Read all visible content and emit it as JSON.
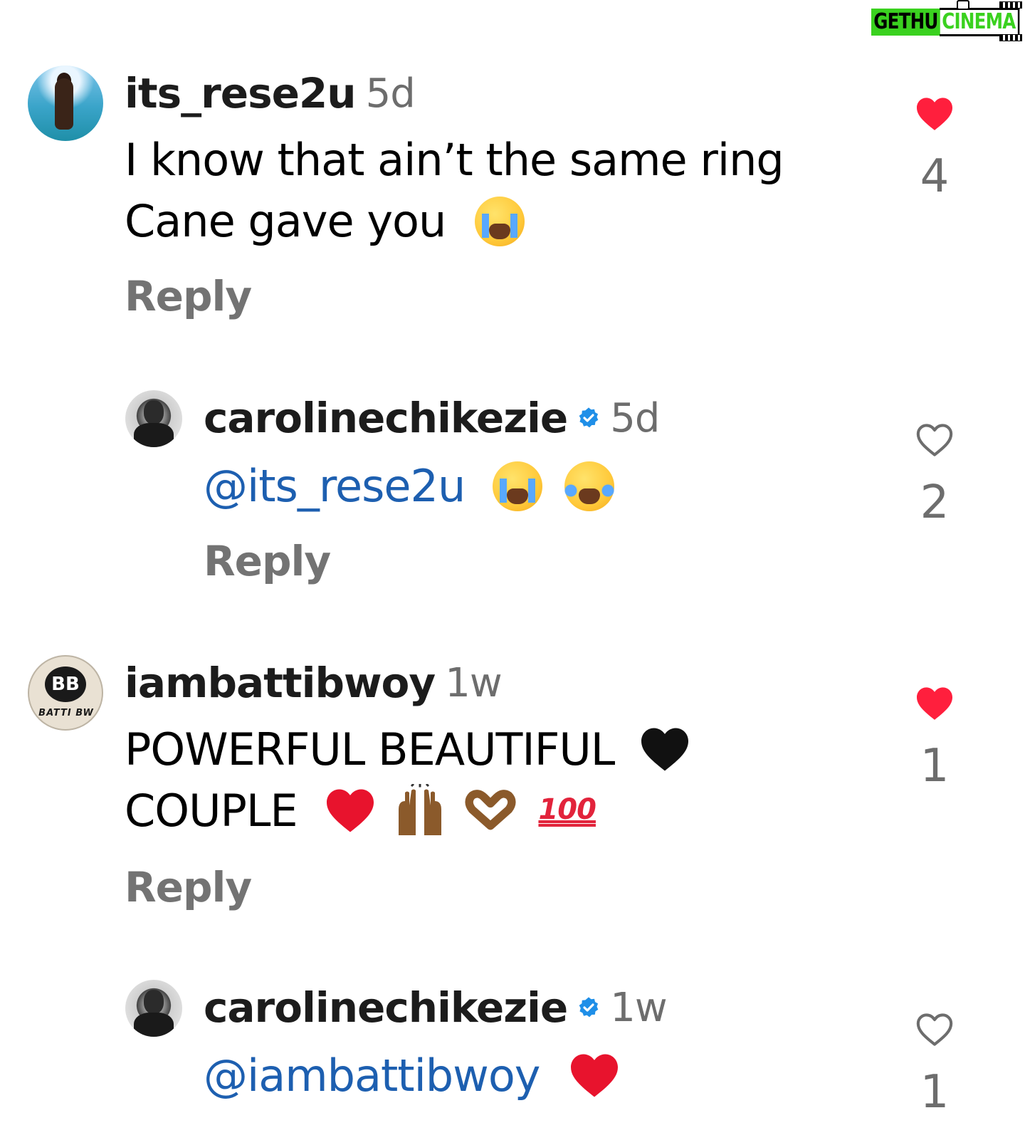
{
  "watermark": {
    "left": "GETHU",
    "right": "CINEMA"
  },
  "comments": [
    {
      "username": "its_rese2u",
      "time": "5d",
      "verified": false,
      "line1": "I know that ain’t the same ring",
      "line2": "Cane gave you",
      "line2_emoji": "loudly-crying-face",
      "reply": "Reply",
      "likes": "4",
      "liked": true
    },
    {
      "username": "carolinechikezie",
      "time": "5d",
      "verified": true,
      "mention": "@its_rese2u",
      "emojis": [
        "loudly-crying-face",
        "face-with-tears-of-joy"
      ],
      "reply": "Reply",
      "likes": "2",
      "liked": false
    },
    {
      "username": "iambattibwoy",
      "time": "1w",
      "verified": false,
      "line1": "POWERFUL BEAUTIFUL",
      "line1_emoji": "black-heart",
      "line2": "COUPLE",
      "line2_emojis": [
        "red-heart",
        "raising-hands",
        "heart-hands",
        "hundred-points"
      ],
      "hundred_text": "100",
      "reply": "Reply",
      "likes": "1",
      "liked": true,
      "avatar_initials": "BB",
      "avatar_caption": "BATTI BW"
    },
    {
      "username": "carolinechikezie",
      "time": "1w",
      "verified": true,
      "mention": "@iambattibwoy",
      "emojis": [
        "red-heart"
      ],
      "likes": "1",
      "liked": false
    }
  ],
  "colors": {
    "like_red": "#ff1f3d",
    "mention_blue": "#1d5fb0",
    "verified_blue": "#1f8fe8",
    "muted_gray": "#737373",
    "watermark_green": "#3ad11f"
  },
  "icons": {
    "liked": "heart-filled-icon",
    "unliked": "heart-outline-icon",
    "verified": "verified-badge-icon"
  }
}
